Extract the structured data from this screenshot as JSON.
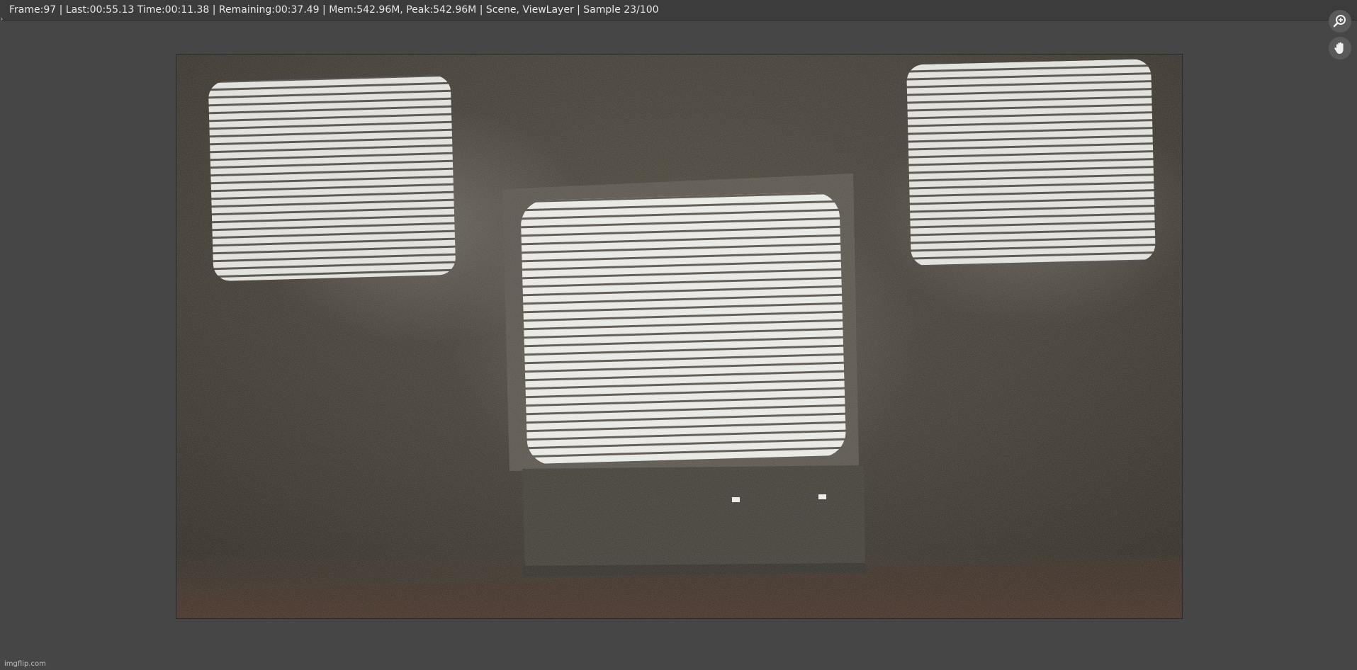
{
  "header": {
    "status": "Frame:97 | Last:00:55.13 Time:00:11.38 | Remaining:00:37.49 | Mem:542.96M, Peak:542.96M | Scene, ViewLayer | Sample 23/100",
    "collapse_icon": "chevron-right-icon"
  },
  "tools": {
    "zoom_icon": "zoom-in-icon",
    "pan_icon": "hand-pan-icon"
  },
  "render": {
    "description_icon": "render-result-image"
  },
  "watermark": {
    "text": "imgflip.com"
  }
}
